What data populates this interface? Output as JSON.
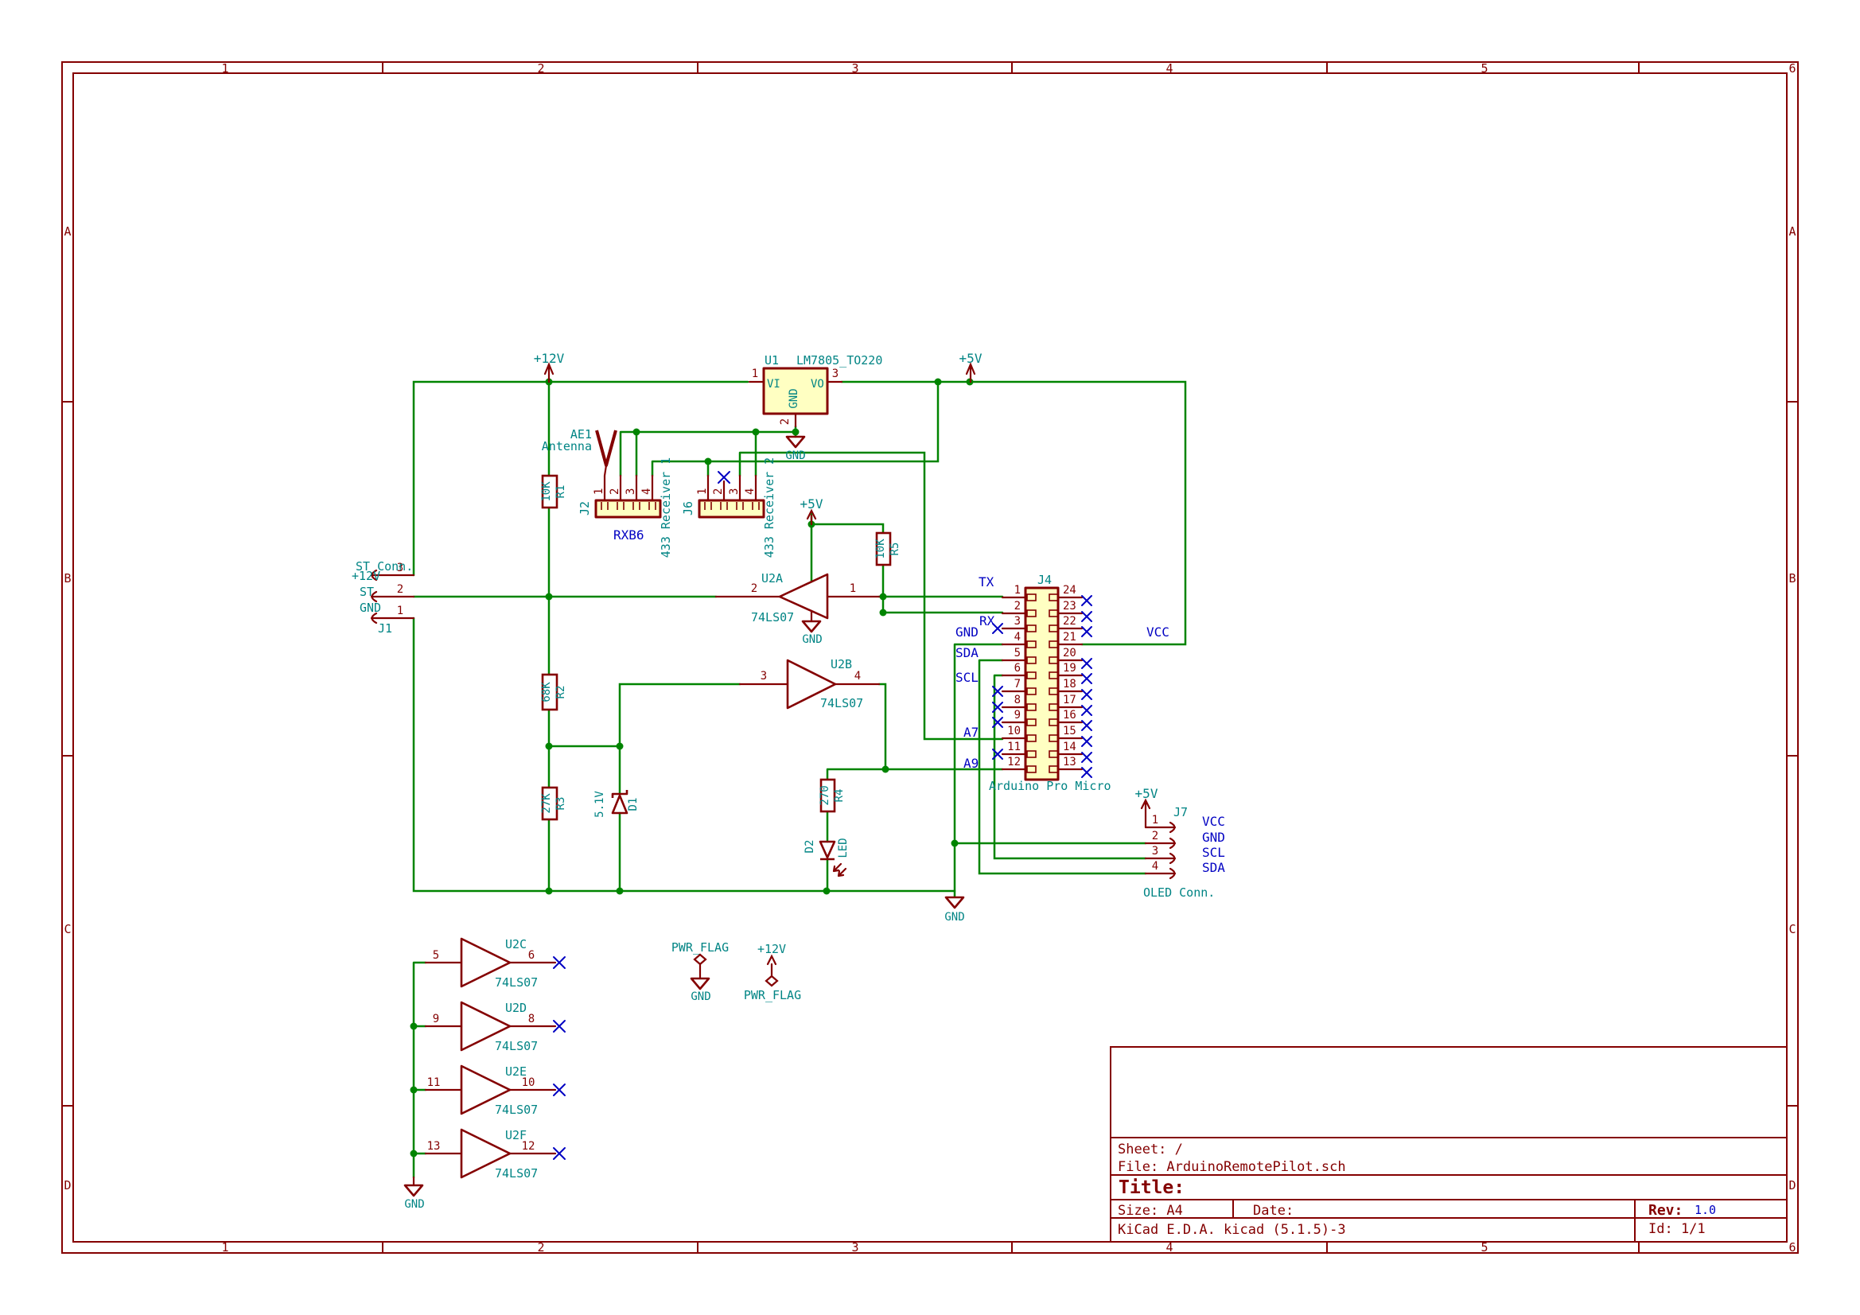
{
  "frame": {
    "columns": [
      "1",
      "2",
      "3",
      "4",
      "5",
      "6"
    ],
    "rows": [
      "A",
      "B",
      "C",
      "D"
    ]
  },
  "title_block": {
    "sheet": "Sheet: /",
    "file": "File: ArduinoRemotePilot.sch",
    "title_label": "Title:",
    "size": "Size: A4",
    "date": "Date:",
    "generator": "KiCad E.D.A.  kicad (5.1.5)-3",
    "rev_label": "Rev:",
    "rev": "1.0",
    "id": "Id: 1/1"
  },
  "power": {
    "p12v": "+12V",
    "p5v": "+5V",
    "gnd": "GND",
    "pwr_flag": "PWR_FLAG"
  },
  "j1": {
    "ref": "J1",
    "name": "ST Conn.",
    "pin3_label": "+12V",
    "pin2_label": "ST",
    "pin1_label": "GND",
    "pins": [
      "3",
      "2",
      "1"
    ]
  },
  "u1": {
    "ref": "U1",
    "value": "LM7805_TO220",
    "pin_vi": "VI",
    "pin_vo": "VO",
    "pin_gnd": "GND",
    "pin1": "1",
    "pin2": "2",
    "pin3": "3"
  },
  "ae1": {
    "ref": "AE1",
    "value": "Antenna"
  },
  "j2": {
    "ref": "J2",
    "value": "RXB6",
    "desc": "433 Receiver 1",
    "pins": [
      "1",
      "2",
      "3",
      "4"
    ]
  },
  "j6": {
    "ref": "J6",
    "desc": "433 Receiver 2",
    "pins": [
      "1",
      "2",
      "3",
      "4"
    ]
  },
  "r1": {
    "ref": "R1",
    "value": "10K"
  },
  "r2": {
    "ref": "R2",
    "value": "68K"
  },
  "r3": {
    "ref": "R3",
    "value": "27K"
  },
  "r4": {
    "ref": "R4",
    "value": "270"
  },
  "r5": {
    "ref": "R5",
    "value": "10K"
  },
  "d1": {
    "ref": "D1",
    "value": "5.1V"
  },
  "d2": {
    "ref": "D2",
    "value": "LED"
  },
  "u2a": {
    "ref": "U2A",
    "value": "74LS07",
    "in": "2",
    "out": "1"
  },
  "u2b": {
    "ref": "U2B",
    "value": "74LS07",
    "in": "3",
    "out": "4"
  },
  "u2c": {
    "ref": "U2C",
    "value": "74LS07",
    "in": "5",
    "out": "6"
  },
  "u2d": {
    "ref": "U2D",
    "value": "74LS07",
    "in": "9",
    "out": "8"
  },
  "u2e": {
    "ref": "U2E",
    "value": "74LS07",
    "in": "11",
    "out": "10"
  },
  "u2f": {
    "ref": "U2F",
    "value": "74LS07",
    "in": "13",
    "out": "12"
  },
  "j4": {
    "ref": "J4",
    "desc": "Arduino Pro Micro",
    "left_pins": [
      "1",
      "2",
      "3",
      "4",
      "5",
      "6",
      "7",
      "8",
      "9",
      "10",
      "11",
      "12"
    ],
    "right_pins": [
      "24",
      "23",
      "22",
      "21",
      "20",
      "19",
      "18",
      "17",
      "16",
      "15",
      "14",
      "13"
    ]
  },
  "j7": {
    "ref": "J7",
    "desc": "OLED Conn.",
    "pins": [
      "1",
      "2",
      "3",
      "4"
    ],
    "labels": [
      "VCC",
      "GND",
      "SCL",
      "SDA"
    ]
  },
  "net_labels": {
    "tx": "TX",
    "rx": "RX",
    "gnd": "GND",
    "sda": "SDA",
    "scl": "SCL",
    "a7": "A7",
    "a9": "A9",
    "vcc": "VCC"
  },
  "colors": {
    "wire": "#008400",
    "outline": "#840000",
    "component_fill": "#FFFFC2",
    "field_text": "#008484",
    "label_text": "#0000C2"
  }
}
